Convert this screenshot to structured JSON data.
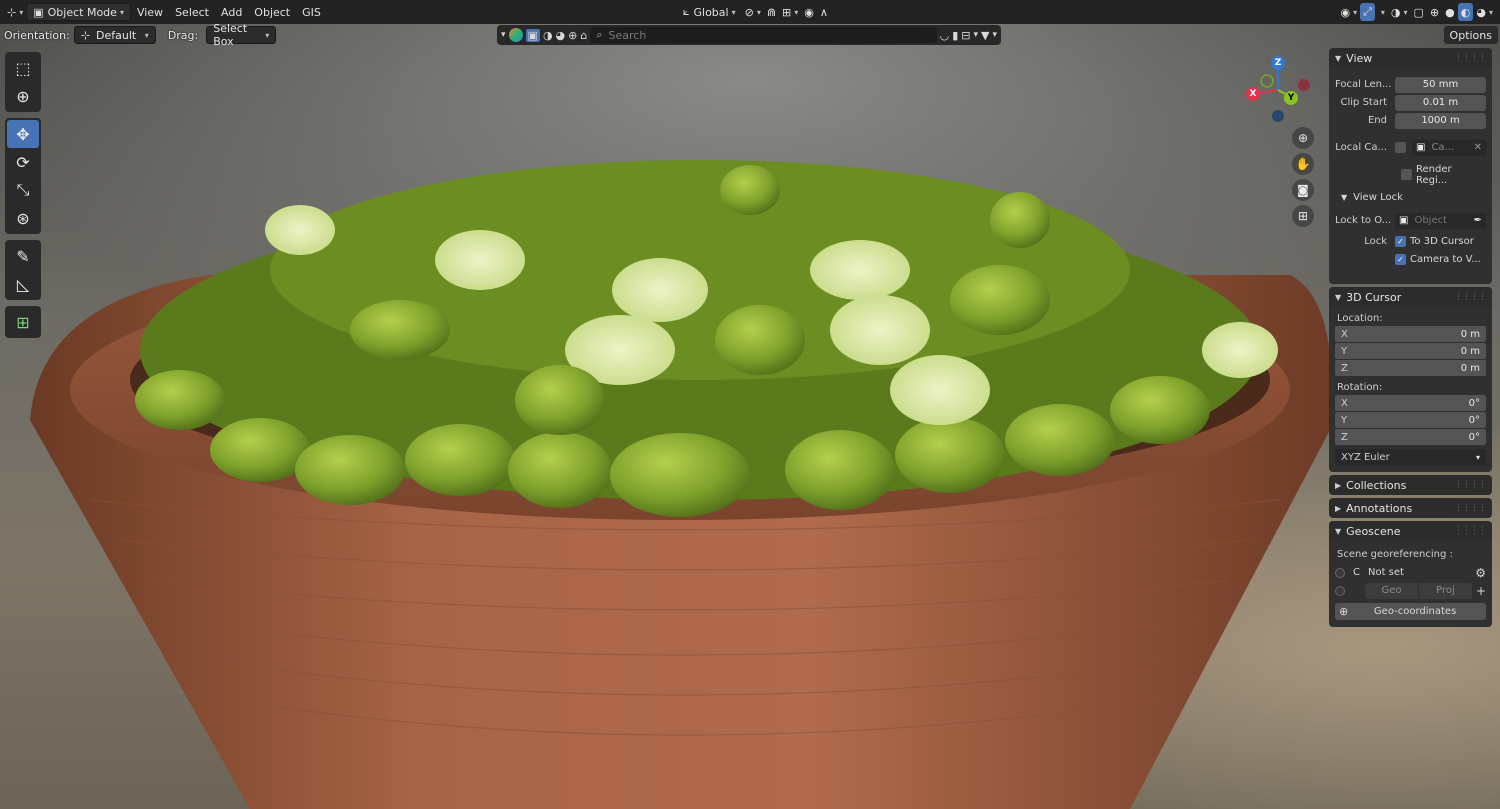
{
  "header": {
    "mode_label": "Object Mode",
    "menu": [
      "View",
      "Select",
      "Add",
      "Object",
      "GIS"
    ],
    "transform_orientation": "Global",
    "options_label": "Options"
  },
  "toolrow": {
    "orientation_label": "Orientation:",
    "orientation_value": "Default",
    "drag_label": "Drag:",
    "drag_value": "Select Box"
  },
  "centerbar": {
    "search_placeholder": "Search"
  },
  "gizmo": {
    "x": "X",
    "y": "Y",
    "z": "Z",
    "colors": {
      "x": "#e0334d",
      "y": "#8bc41d",
      "z": "#2e7ad6"
    }
  },
  "sidebar": {
    "view": {
      "title": "View",
      "focal_label": "Focal Len...",
      "focal_value": "50 mm",
      "clip_start_label": "Clip Start",
      "clip_start_value": "0.01 m",
      "end_label": "End",
      "end_value": "1000 m",
      "local_camera_label": "Local Ca...",
      "local_camera_value": "Ca...",
      "render_region_label": "Render Regi...",
      "view_lock_title": "View Lock",
      "lock_to_object_label": "Lock to O...",
      "lock_to_object_placeholder": "Object",
      "lock_label": "Lock",
      "to_3d_cursor": "To 3D Cursor",
      "camera_to_view": "Camera to V..."
    },
    "cursor": {
      "title": "3D Cursor",
      "location_label": "Location:",
      "loc_x_label": "X",
      "loc_x": "0 m",
      "loc_y_label": "Y",
      "loc_y": "0 m",
      "loc_z_label": "Z",
      "loc_z": "0 m",
      "rotation_label": "Rotation:",
      "rot_x_label": "X",
      "rot_x": "0°",
      "rot_y_label": "Y",
      "rot_y": "0°",
      "rot_z_label": "Z",
      "rot_z": "0°",
      "rotation_mode": "XYZ Euler"
    },
    "collections_title": "Collections",
    "annotations_title": "Annotations",
    "geoscene": {
      "title": "Geoscene",
      "georef_label": "Scene georeferencing :",
      "crs_code": "C",
      "crs_value": "Not set",
      "geo_label": "Geo",
      "proj_label": "Proj",
      "geocoords_label": "Geo-coordinates"
    }
  }
}
